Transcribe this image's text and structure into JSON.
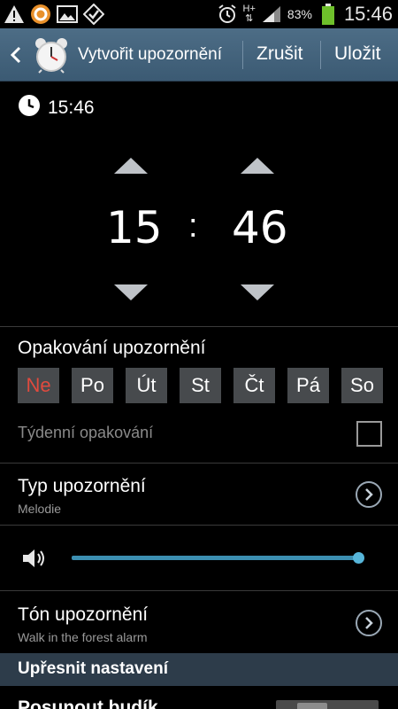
{
  "status_bar": {
    "left_icons": [
      "warning-icon",
      "chat-icon",
      "gallery-icon",
      "checkmark-app-icon"
    ],
    "right_icons": [
      "alarm-icon",
      "network-hplus-icon",
      "signal-icon",
      "battery-icon"
    ],
    "network_label": "H+",
    "battery": "83%",
    "time": "15:46"
  },
  "action_bar": {
    "title": "Vytvořit upozornění",
    "cancel_label": "Zrušit",
    "save_label": "Uložit",
    "color": "#44647d"
  },
  "current_time": "15:46",
  "time_picker": {
    "hours": "15",
    "separator": ":",
    "minutes": "46"
  },
  "repeat": {
    "title": "Opakování upozornění",
    "days": [
      {
        "label": "Ne",
        "selected": true,
        "color": "#e04a3e"
      },
      {
        "label": "Po"
      },
      {
        "label": "Út"
      },
      {
        "label": "St"
      },
      {
        "label": "Čt"
      },
      {
        "label": "Pá"
      },
      {
        "label": "So"
      }
    ],
    "weekly_label": "Týdenní opakování",
    "weekly_checked": false
  },
  "alarm_type": {
    "title": "Typ upozornění",
    "value": "Melodie"
  },
  "volume": {
    "level": 1.0,
    "accent": "#3c8fb1"
  },
  "alarm_tone": {
    "title": "Tón upozornění",
    "value": "Walk in the forest alarm"
  },
  "advanced": {
    "header": "Upřesnit nastavení",
    "next_item": "Posunout budík"
  }
}
